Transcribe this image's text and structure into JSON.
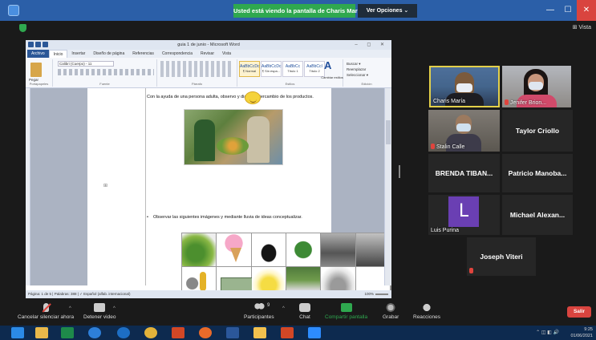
{
  "titlebar": {
    "share_banner": "Usted está viendo la pantalla de Charis María",
    "view_options": "Ver Opciones ⌄",
    "controls": [
      "—",
      "☐",
      "✕"
    ]
  },
  "top_right": {
    "view": "⊞ Vista"
  },
  "word": {
    "title": "guia 1 de junio  -  Microsoft Word",
    "window_controls": "–  ◻  ✕",
    "tabs": [
      "Archivo",
      "Inicio",
      "Insertar",
      "Diseño de página",
      "Referencias",
      "Correspondencia",
      "Revisar",
      "Vista"
    ],
    "font": "Calibri (Cuerpo)  - 11",
    "paste": "Pegar",
    "groups": [
      "Portapapeles",
      "Fuente",
      "Párrafo",
      "Estilos",
      "Edición"
    ],
    "styles": [
      {
        "sample": "AaBbCcDc",
        "name": "¶ Normal"
      },
      {
        "sample": "AaBbCcDc",
        "name": "¶ Sin espa..."
      },
      {
        "sample": "AaBbCc",
        "name": "Título 1"
      },
      {
        "sample": "AaBbCcI",
        "name": "Título 2"
      }
    ],
    "change_styles": "Cambiar estilos",
    "editing": [
      "Buscar ▾",
      "Reemplazar",
      "Seleccionar ▾"
    ],
    "doc_line1": "Con la ayuda de una persona adulta, observo y dial       del intercambio de los productos.",
    "doc_line2": "Observar las siguientes imágenes y mediante lluvia de ideas conceptualizar.",
    "margin_mark": "⊞",
    "status": "Página: 1 de 5  |  Palabras: 388  |  ✓  Español (alfab. internacional)",
    "zoom": "100%"
  },
  "participants": [
    {
      "name": "Charis María",
      "type": "video"
    },
    {
      "name": "Jenifer Brion...",
      "type": "video"
    },
    {
      "name": "Stalin Calle",
      "type": "video",
      "muted": true
    },
    {
      "name": "Taylor Criollo",
      "type": "name"
    },
    {
      "name": "BRENDA TIBAN...",
      "type": "name"
    },
    {
      "name": "Patricio Manoba...",
      "type": "name"
    },
    {
      "name": "Luis Purina",
      "type": "avatar",
      "initial": "L"
    },
    {
      "name": "Michael Alexan...",
      "type": "name"
    },
    {
      "name": "Joseph Viteri",
      "type": "name"
    }
  ],
  "toolbar": {
    "mic": "Cancelar silenciar ahora",
    "video": "Detener video",
    "participants": "Participantes",
    "participants_count": "9",
    "chat": "Chat",
    "share": "Compartir pantalla",
    "record": "Grabar",
    "reactions": "Reacciones",
    "leave": "Salir"
  },
  "taskbar": {
    "time": "9:25",
    "date": "01/06/2021"
  },
  "colors": {
    "share_green": "#2fa84f",
    "leave_red": "#d9443f",
    "titlebar_blue": "#2b5fa8",
    "active_speaker": "#e3d04a"
  }
}
